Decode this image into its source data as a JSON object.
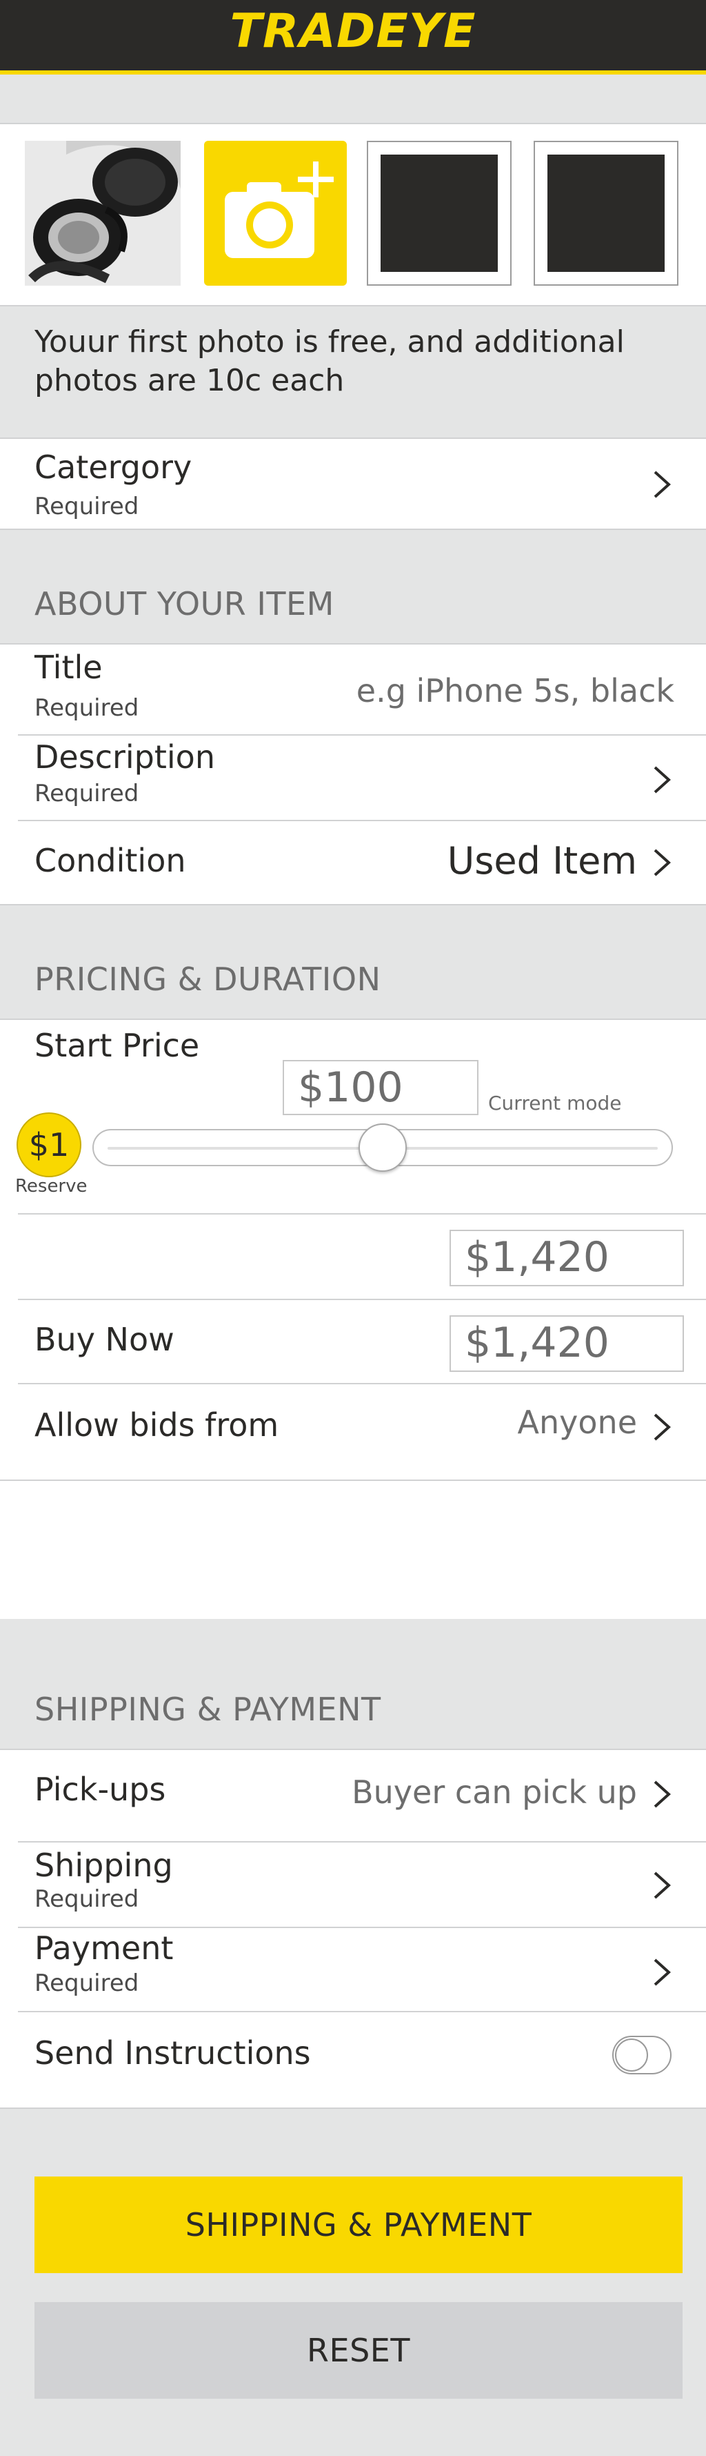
{
  "app": {
    "title": "TRADEYE"
  },
  "photos": {
    "note": "Youur first photo is free, and additional photos are 10c each"
  },
  "category": {
    "label": "Catergory",
    "sub": "Required"
  },
  "about": {
    "section": "ABOUT YOUR ITEM",
    "title_label": "Title",
    "title_sub": "Required",
    "title_placeholder": "e.g iPhone 5s, black",
    "description_label": "Description",
    "description_sub": "Required",
    "condition_label": "Condition",
    "condition_value": "Used Item"
  },
  "pricing": {
    "section": "PRICING & DURATION",
    "start_price_label": "Start Price",
    "start_price_value": "$100",
    "current_mode": "Current mode",
    "reserve_value": "$1",
    "reserve_label": "Reserve",
    "slider_position": 0.5,
    "amount_value": "$1,420",
    "buy_now_label": "Buy Now",
    "buy_now_value": "$1,420",
    "allow_bids_label": "Allow bids from",
    "allow_bids_value": "Anyone"
  },
  "shipping": {
    "section": "SHIPPING & PAYMENT",
    "pickups_label": "Pick-ups",
    "pickups_value": "Buyer can pick up",
    "shipping_label": "Shipping",
    "shipping_sub": "Required",
    "payment_label": "Payment",
    "payment_sub": "Required",
    "instructions_label": "Send Instructions",
    "instructions_on": false
  },
  "buttons": {
    "primary": "SHIPPING & PAYMENT",
    "secondary": "RESET"
  },
  "colors": {
    "brand_yellow": "#f9d800",
    "dark": "#2b2a28",
    "background": "#e4e5e5"
  }
}
